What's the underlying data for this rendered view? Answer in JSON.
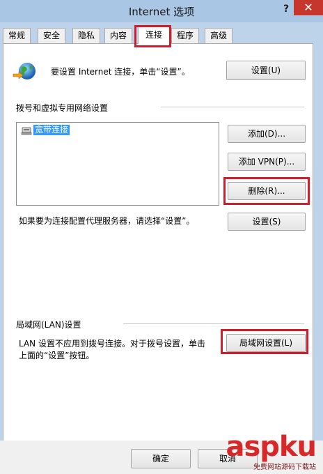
{
  "window": {
    "title": "Internet 选项",
    "help_label": "?",
    "close_label": "✕"
  },
  "tabs": [
    {
      "label": "常规"
    },
    {
      "label": "安全"
    },
    {
      "label": "隐私"
    },
    {
      "label": "内容"
    },
    {
      "label": "连接",
      "active": true
    },
    {
      "label": "程序"
    },
    {
      "label": "高级"
    }
  ],
  "setup": {
    "text": "要设置 Internet 连接，单击“设置”。",
    "button": "设置(U)"
  },
  "dialup": {
    "group_label": "拨号和虚拟专用网络设置",
    "list_item": "宽带连接",
    "add_button": "添加(D)...",
    "add_vpn_button": "添加 VPN(P)...",
    "delete_button": "删除(R)...",
    "proxy_text": "如果要为连接配置代理服务器，请选择“设置”。",
    "settings_button": "设置(S)"
  },
  "lan": {
    "group_label": "局域网(LAN)设置",
    "text_line1": "LAN 设置不应用到拨号连接。对于拨号设置，单击",
    "text_line2": "上面的“设置”按钮。",
    "button": "局域网设置(L)"
  },
  "footer": {
    "ok_button": "确定",
    "cancel_button": "取消"
  },
  "watermark": {
    "brand": "aspku",
    "sub": "免费网站源码下载站"
  },
  "colors": {
    "highlight": "#d01e2c",
    "selection": "#3399ff",
    "close": "#c7362c"
  }
}
